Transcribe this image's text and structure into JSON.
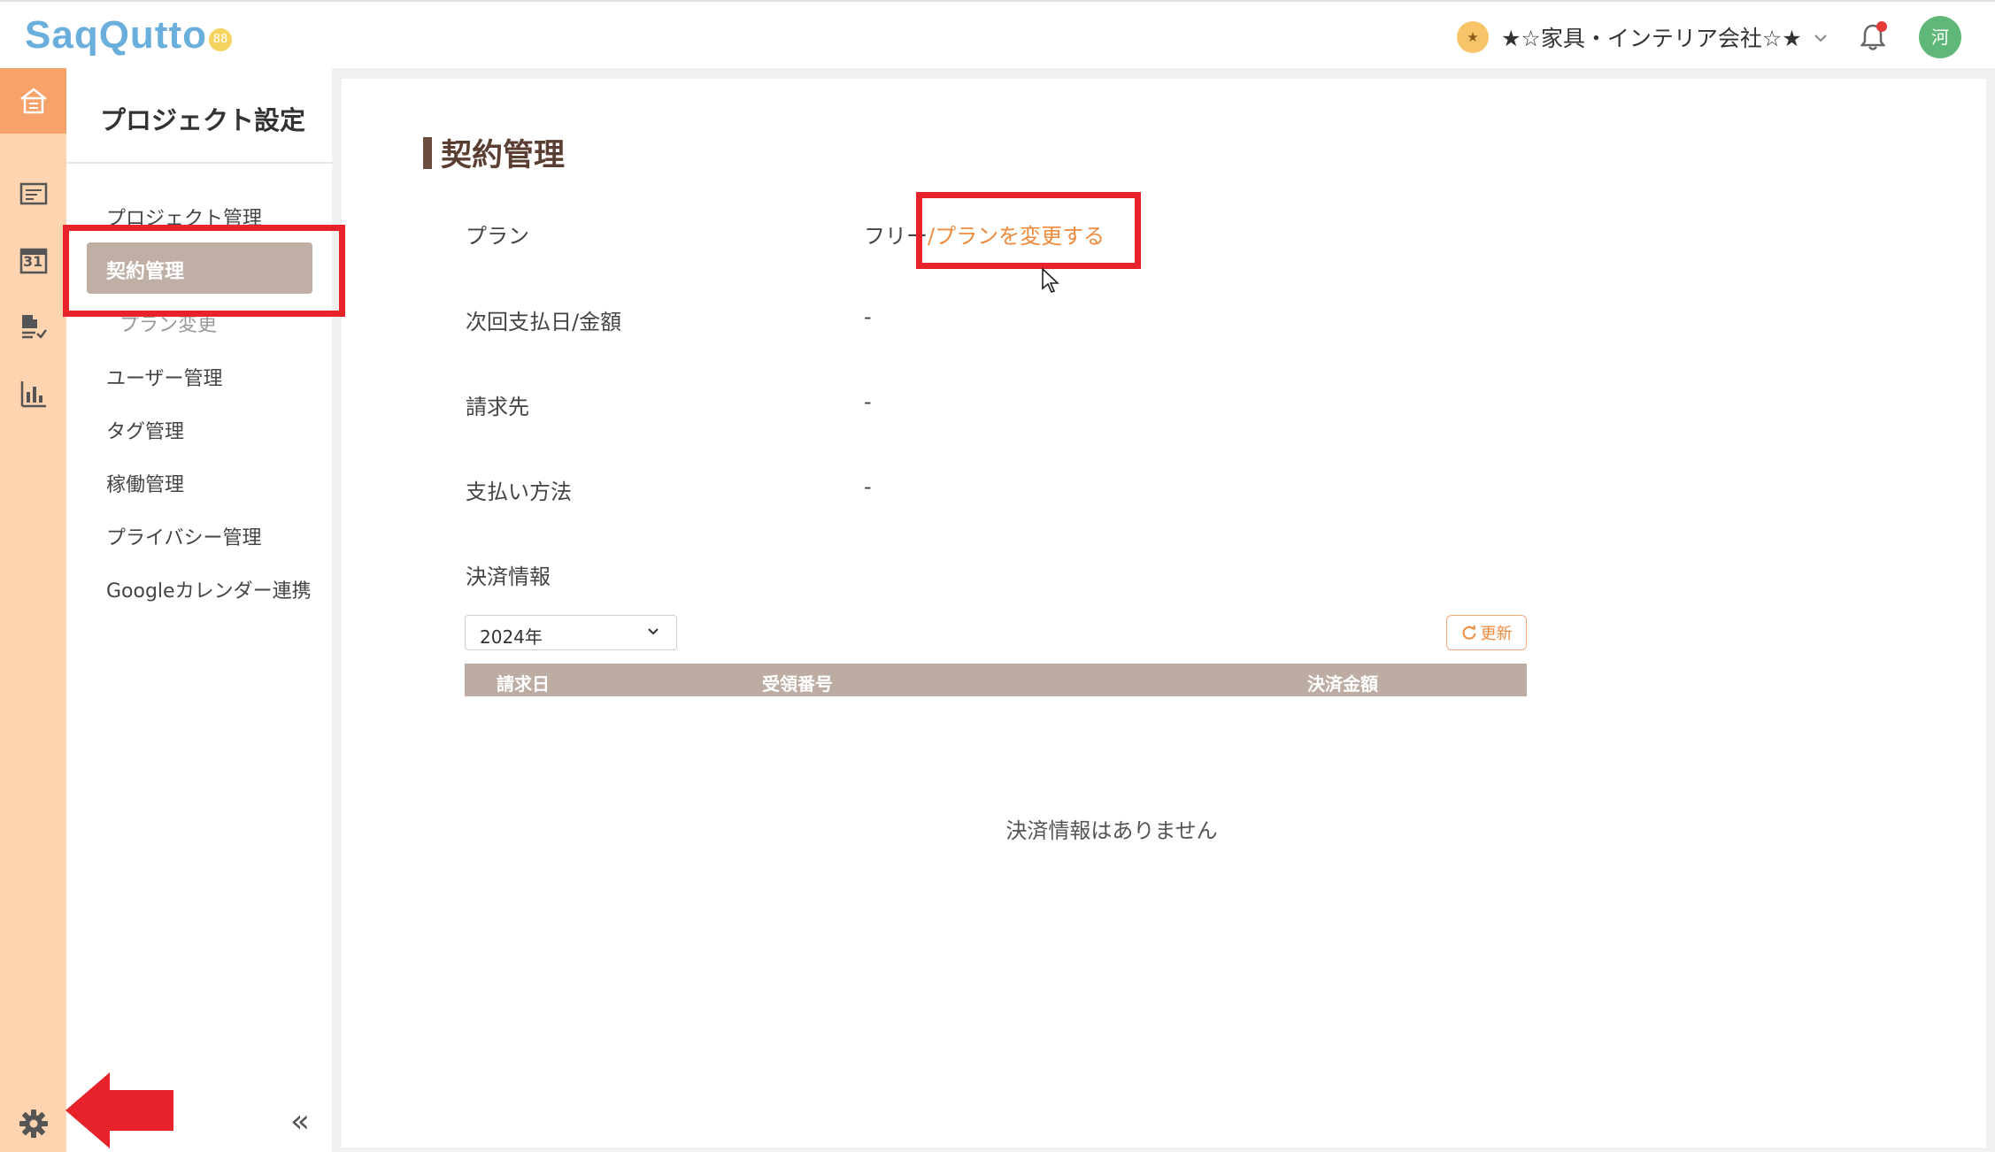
{
  "header": {
    "logo_text": "SaqQutto",
    "logo_badge": "88",
    "company_icon": "★",
    "company_name": "★☆家具・インテリア会社☆★",
    "company_chevron": "chevron-down-icon",
    "bell_icon": "bell-icon",
    "avatar_initial": "河"
  },
  "rail": {
    "items": [
      "home-icon",
      "task-list-icon",
      "calendar-icon",
      "document-check-icon",
      "bar-chart-icon"
    ],
    "calendar_day": "31",
    "settings": "gear-icon"
  },
  "sidebar": {
    "title": "プロジェクト設定",
    "items": [
      {
        "label": "プロジェクト管理"
      },
      {
        "label": "契約管理",
        "active": true
      },
      {
        "label": "プラン変更",
        "sub": true
      },
      {
        "label": "ユーザー管理"
      },
      {
        "label": "タグ管理"
      },
      {
        "label": "稼働管理"
      },
      {
        "label": "プライバシー管理"
      },
      {
        "label": "Googleカレンダー連携"
      }
    ],
    "collapse_label": "«"
  },
  "main": {
    "title": "契約管理",
    "rows": [
      {
        "label": "プラン",
        "value": "フリー",
        "link": "/プランを変更する"
      },
      {
        "label": "次回支払日/金額",
        "value": "-"
      },
      {
        "label": "請求先",
        "value": "-"
      },
      {
        "label": "支払い方法",
        "value": "-"
      }
    ],
    "payment_section": "決済情報",
    "year_select": "2024年",
    "refresh_label": "更新",
    "table_headers": [
      "請求日",
      "受領番号",
      "決済金額"
    ],
    "empty_message": "決済情報はありません"
  },
  "colors": {
    "accent": "#f08a3c",
    "rail_bg": "#ffd4b0",
    "rail_active": "#f7a26b",
    "nav_active": "#bfafa5",
    "table_header": "#bdaca2",
    "title_brown": "#5a3e32",
    "annotation_red": "#e8222b"
  }
}
